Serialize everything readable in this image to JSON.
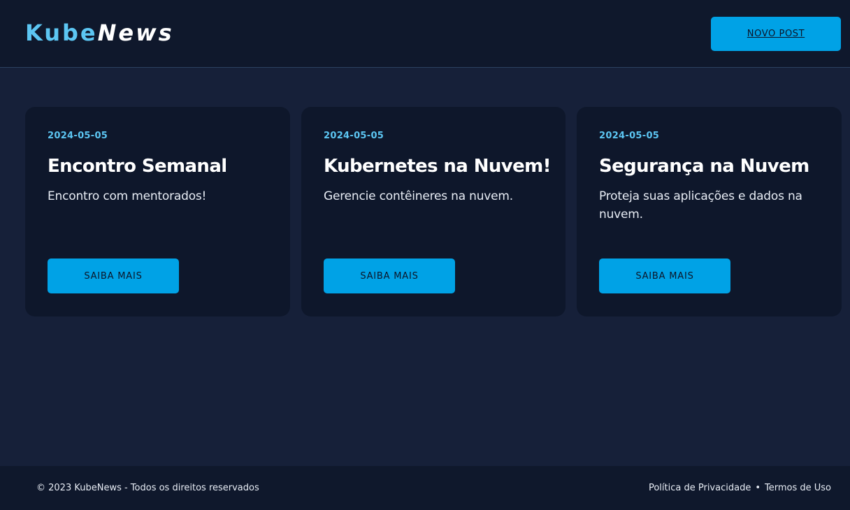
{
  "header": {
    "logo_part1": "Kube",
    "logo_part2": "News",
    "new_post_label": "NOVO POST"
  },
  "posts": [
    {
      "date": "2024-05-05",
      "title": "Encontro Semanal",
      "description": "Encontro com mentorados!",
      "button_label": "SAIBA MAIS"
    },
    {
      "date": "2024-05-05",
      "title": "Kubernetes na Nuvem!",
      "description": "Gerencie contêineres na nuvem.",
      "button_label": "SAIBA MAIS"
    },
    {
      "date": "2024-05-05",
      "title": "Segurança na Nuvem",
      "description": "Proteja suas aplicações e dados na nuvem.",
      "button_label": "SAIBA MAIS"
    }
  ],
  "footer": {
    "copyright": "© 2023 KubeNews - Todos os direitos reservados",
    "privacy_label": "Política de Privacidade",
    "separator": "•",
    "terms_label": "Termos de Uso"
  },
  "colors": {
    "background": "#162039",
    "header_bg": "#0f182c",
    "card_bg": "#0e172b",
    "accent": "#00a2e6",
    "logo_accent": "#5cc6f3"
  }
}
